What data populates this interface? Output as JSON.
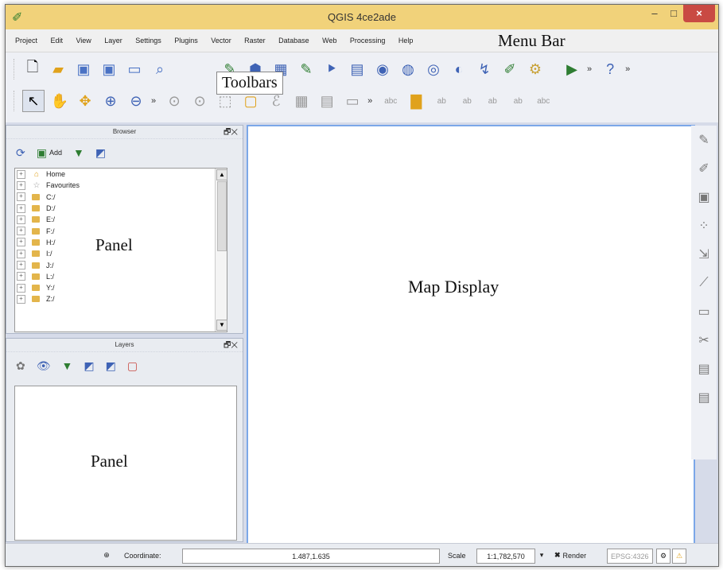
{
  "window": {
    "title": "QGIS 4ce2ade",
    "controls": {
      "minimize": "–",
      "maximize": "□",
      "close": "×"
    }
  },
  "menu": {
    "items": [
      "Project",
      "Edit",
      "View",
      "Layer",
      "Settings",
      "Plugins",
      "Vector",
      "Raster",
      "Database",
      "Web",
      "Processing",
      "Help"
    ]
  },
  "annotations": {
    "menu_bar": "Menu Bar",
    "toolbars": "Toolbars",
    "panel_browser": "Panel",
    "panel_layers": "Panel",
    "map_display": "Map Display"
  },
  "toolbars": {
    "row1": [
      {
        "name": "new-project-icon",
        "glyph": "🗋"
      },
      {
        "name": "open-project-icon",
        "glyph": "📁"
      },
      {
        "name": "save-project-icon",
        "glyph": "💾"
      },
      {
        "name": "save-as-icon",
        "glyph": "💾"
      },
      {
        "name": "print-composer-icon",
        "glyph": "🖨"
      },
      {
        "name": "composer-manager-icon",
        "glyph": "🔍"
      }
    ],
    "row1_more": [
      {
        "name": "digitize-icon",
        "glyph": "✎"
      },
      {
        "name": "add-vector-layer-icon",
        "glyph": "⬢"
      },
      {
        "name": "add-raster-layer-icon",
        "glyph": "▦"
      },
      {
        "name": "add-postgis-icon",
        "glyph": "🐘"
      },
      {
        "name": "add-spatialite-icon",
        "glyph": "◆"
      },
      {
        "name": "add-mssql-icon",
        "glyph": "▣"
      },
      {
        "name": "add-wms-icon",
        "glyph": "🌐"
      },
      {
        "name": "add-wcs-icon",
        "glyph": "🌐"
      },
      {
        "name": "add-wfs-icon",
        "glyph": "🌐"
      },
      {
        "name": "add-delimited-text-icon",
        "glyph": "↯"
      },
      {
        "name": "new-shapefile-icon",
        "glyph": "✎"
      },
      {
        "name": "plugin-icon",
        "glyph": "⚙"
      }
    ],
    "row1_end": [
      {
        "name": "green-plugin-icon",
        "glyph": "▶"
      },
      {
        "name": "help-icon",
        "glyph": "?"
      }
    ],
    "row2": [
      {
        "name": "touch-zoom-icon",
        "glyph": "↖"
      },
      {
        "name": "pan-icon",
        "glyph": "✋"
      },
      {
        "name": "pan-to-selection-icon",
        "glyph": "✥"
      },
      {
        "name": "zoom-in-icon",
        "glyph": "⊕"
      },
      {
        "name": "zoom-out-icon",
        "glyph": "⊖"
      }
    ],
    "row2_more": [
      {
        "name": "identify-icon",
        "glyph": "ℹ"
      },
      {
        "name": "measure-icon",
        "glyph": "⌖"
      },
      {
        "name": "select-icon",
        "glyph": "⬚"
      },
      {
        "name": "deselect-icon",
        "glyph": "▢"
      },
      {
        "name": "expression-icon",
        "glyph": "ℰ"
      },
      {
        "name": "attribute-table-icon",
        "glyph": "▦"
      },
      {
        "name": "field-calculator-icon",
        "glyph": "▤"
      },
      {
        "name": "statistics-icon",
        "glyph": "▭"
      }
    ],
    "row2_labels": [
      {
        "name": "label-icon",
        "glyph": "abc"
      },
      {
        "name": "label-highlight-icon",
        "glyph": "▇"
      },
      {
        "name": "pin-label-icon",
        "glyph": "ab"
      },
      {
        "name": "show-hide-label-icon",
        "glyph": "ab"
      },
      {
        "name": "move-label-icon",
        "glyph": "ab"
      },
      {
        "name": "rotate-label-icon",
        "glyph": "ab"
      },
      {
        "name": "change-label-icon",
        "glyph": "abc"
      }
    ]
  },
  "browser": {
    "title": "Browser",
    "toolbar": {
      "add_label": "Add"
    },
    "items": [
      {
        "label": "Home",
        "type": "home"
      },
      {
        "label": "Favourites",
        "type": "fav"
      },
      {
        "label": "C:/",
        "type": "folder"
      },
      {
        "label": "D:/",
        "type": "folder"
      },
      {
        "label": "E:/",
        "type": "folder"
      },
      {
        "label": "F:/",
        "type": "folder"
      },
      {
        "label": "H:/",
        "type": "folder"
      },
      {
        "label": "I:/",
        "type": "folder"
      },
      {
        "label": "J:/",
        "type": "folder"
      },
      {
        "label": "L:/",
        "type": "folder"
      },
      {
        "label": "Y:/",
        "type": "folder"
      },
      {
        "label": "Z:/",
        "type": "folder"
      }
    ]
  },
  "layers": {
    "title": "Layers"
  },
  "status": {
    "coordinate_label": "Coordinate:",
    "coordinate_value": "1.487,1.635",
    "scale_label": "Scale",
    "scale_value": "1:1,782,570",
    "render_label": "Render",
    "epsg": "EPSG:4326"
  }
}
